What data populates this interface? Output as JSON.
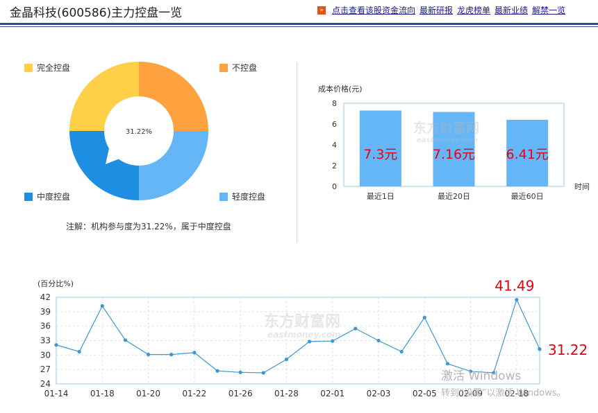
{
  "header": {
    "title": "金晶科技(600586)主力控盘一览",
    "links": [
      "点击查看该股资金流向",
      "最新研报",
      "龙虎榜单",
      "最新业绩",
      "解禁一览"
    ]
  },
  "pie": {
    "center_label": "31.22%",
    "legend": [
      {
        "label": "完全控盘",
        "color": "#fecf47"
      },
      {
        "label": "不控盘",
        "color": "#fea23f"
      },
      {
        "label": "中度控盘",
        "color": "#1e8ee3"
      },
      {
        "label": "轻度控盘",
        "color": "#65b6f7"
      }
    ],
    "note": "注解：机构参与度为31.22%，属于中度控盘"
  },
  "chart_data": [
    {
      "type": "bar",
      "ylabel": "成本价格(元)",
      "xlabel": "时间",
      "categories": [
        "最近1日",
        "最近20日",
        "最近60日"
      ],
      "values": [
        7.3,
        7.16,
        6.41
      ],
      "data_labels": [
        "7.3元",
        "7.16元",
        "6.41元"
      ],
      "ylim": [
        0,
        8
      ],
      "yticks": [
        "0",
        "2",
        "4",
        "6",
        "8"
      ],
      "bar_color": "#65b6f7",
      "label_color": "#e60012"
    },
    {
      "type": "line",
      "ylabel": "(百分比%)",
      "ylim": [
        24,
        42
      ],
      "yticks": [
        "24",
        "27",
        "30",
        "33",
        "36",
        "39",
        "42"
      ],
      "xticks": [
        "01-14",
        "01-18",
        "01-20",
        "01-22",
        "01-26",
        "01-28",
        "02-01",
        "02-03",
        "02-05",
        "02-09",
        "02-18"
      ],
      "values": [
        32.1,
        30.7,
        40.2,
        33.1,
        30.1,
        30.1,
        30.5,
        26.7,
        26.4,
        26.3,
        29.1,
        32.8,
        32.9,
        35.5,
        33.0,
        30.7,
        37.8,
        28.2,
        26.6,
        26.3,
        41.49,
        31.22
      ],
      "annotations": [
        {
          "index": 20,
          "text": "41.49"
        },
        {
          "index": 21,
          "text": "31.22"
        }
      ],
      "line_color": "#3a97d8",
      "annotation_color": "#e60012"
    }
  ],
  "watermark": {
    "brand": "东方财富网",
    "domain": "eastmoney.com"
  },
  "windows_activation": {
    "line1": "激活 Windows",
    "line2": "转到“设置”以激活 Windows。"
  }
}
